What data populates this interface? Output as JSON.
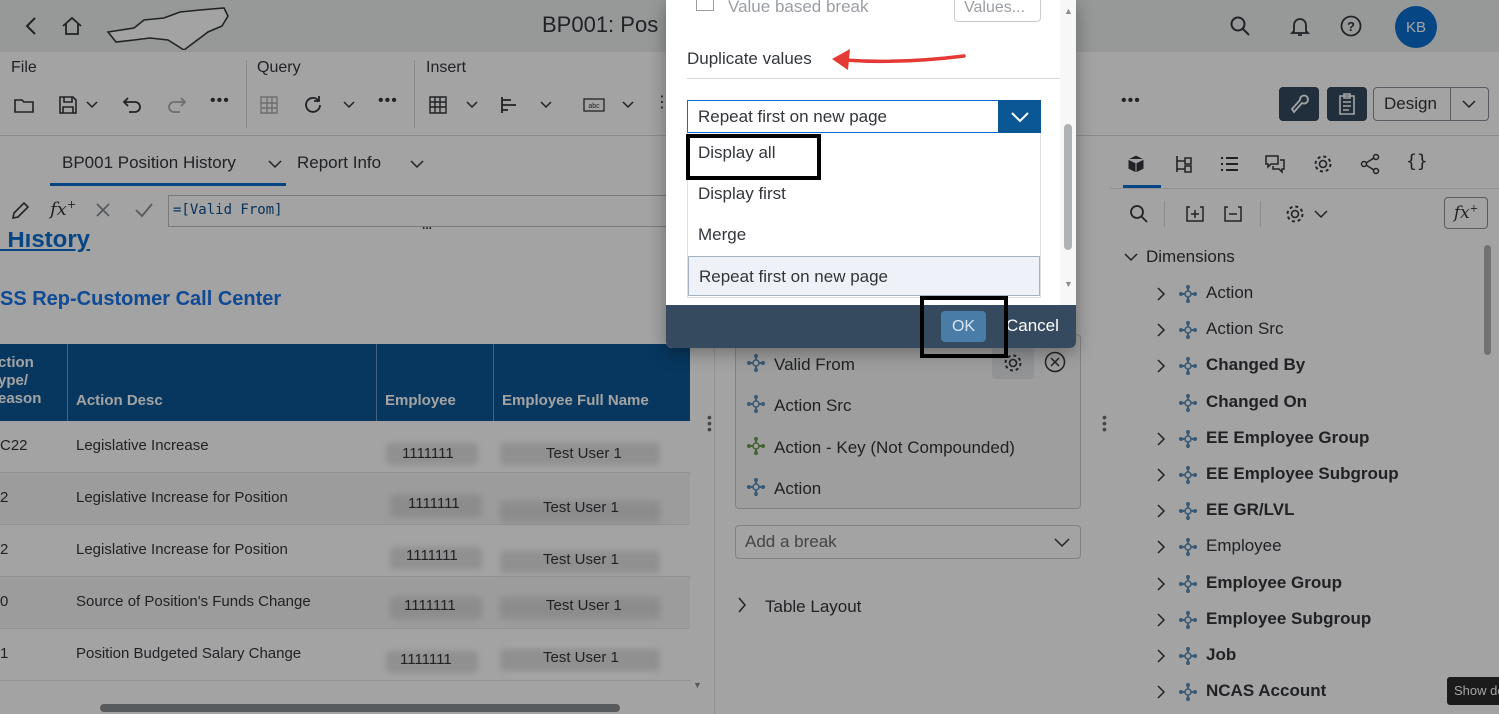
{
  "shell": {
    "title": "BP001: Pos",
    "avatar_initials": "KB",
    "accent": "#0a6ed1",
    "header_dark": "#354a5f"
  },
  "toolbar": {
    "file_label": "File",
    "query_label": "Query",
    "insert_label": "Insert",
    "design_label": "Design"
  },
  "tabs": {
    "report_tab": "BP001 Position History",
    "info_tab": "Report Info"
  },
  "formula": {
    "value": "=[Valid From]",
    "more": "..."
  },
  "report": {
    "title": "n History",
    "subtitle": "SS Rep-Customer Call Center",
    "columns": [
      "ction\nype/\neason",
      "Action Desc",
      "Employee",
      "Employee Full Name"
    ],
    "col0_lines": [
      "ction",
      "ype/",
      "eason"
    ],
    "rows": [
      {
        "code": "C22",
        "desc": "Legislative Increase",
        "emp": "1111111",
        "name": "Test User 1"
      },
      {
        "code": "2",
        "desc": "Legislative Increase for Position",
        "emp": "1111111",
        "name": "Test User 1"
      },
      {
        "code": "2",
        "desc": "Legislative Increase for Position",
        "emp": "1111111",
        "name": "Test User 1"
      },
      {
        "code": "0",
        "desc": "Source of Position's Funds Change",
        "emp": "1111111",
        "name": "Test User 1"
      },
      {
        "code": "1",
        "desc": "Position Budgeted Salary Change",
        "emp": "1111111",
        "name": "Test User 1"
      }
    ]
  },
  "breaks": {
    "items": [
      "Valid From",
      "Action Src",
      "Action - Key (Not Compounded)",
      "Action"
    ],
    "add_placeholder": "Add a break",
    "table_layout": "Table Layout"
  },
  "dimensions": {
    "header": "Dimensions",
    "items": [
      {
        "label": "Action",
        "bold": false,
        "expandable": true
      },
      {
        "label": "Action Src",
        "bold": false,
        "expandable": true
      },
      {
        "label": "Changed By",
        "bold": true,
        "expandable": true
      },
      {
        "label": "Changed On",
        "bold": true,
        "expandable": false
      },
      {
        "label": "EE Employee Group",
        "bold": true,
        "expandable": true
      },
      {
        "label": "EE Employee Subgroup",
        "bold": true,
        "expandable": true
      },
      {
        "label": "EE GR/LVL",
        "bold": true,
        "expandable": true
      },
      {
        "label": "Employee",
        "bold": false,
        "expandable": true
      },
      {
        "label": "Employee Group",
        "bold": true,
        "expandable": true
      },
      {
        "label": "Employee Subgroup",
        "bold": true,
        "expandable": true
      },
      {
        "label": "Job",
        "bold": true,
        "expandable": true
      },
      {
        "label": "NCAS Account",
        "bold": true,
        "expandable": true
      }
    ]
  },
  "tooltip": "Show de",
  "dialog": {
    "value_based_break": "Value based break",
    "values_button": "Values...",
    "duplicate_label": "Duplicate values",
    "selected_value": "Repeat first on new page",
    "options": [
      "Display all",
      "Display first",
      "Merge",
      "Repeat first on new page"
    ],
    "ok": "OK",
    "cancel": "Cancel"
  }
}
